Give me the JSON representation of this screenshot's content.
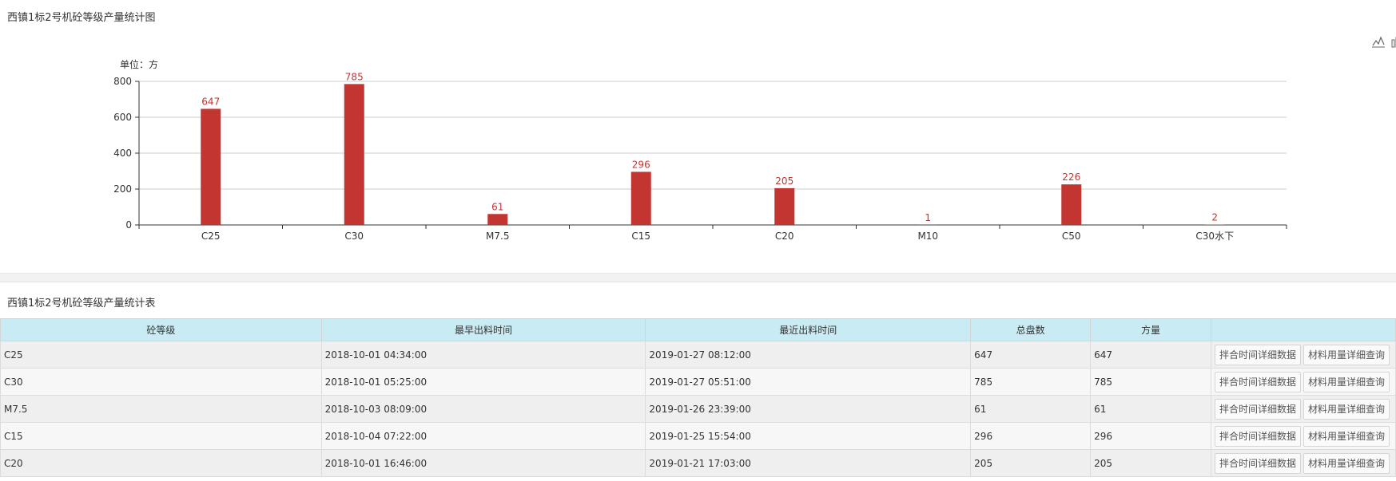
{
  "chart_panel": {
    "title": "西镇1标2号机砼等级产量统计图"
  },
  "table_panel": {
    "title": "西镇1标2号机砼等级产量统计表"
  },
  "toolbox": [
    "line-chart-icon",
    "bar-chart-icon"
  ],
  "chart_data": {
    "type": "bar",
    "title": "",
    "ylabel": "单位：方",
    "xlabel": "",
    "categories": [
      "C25",
      "C30",
      "M7.5",
      "C15",
      "C20",
      "M10",
      "C50",
      "C30水下"
    ],
    "values": [
      647,
      785,
      61,
      296,
      205,
      1,
      226,
      2
    ],
    "ylim": [
      0,
      800
    ],
    "yticks": [
      0,
      200,
      400,
      600,
      800
    ],
    "grid": true,
    "bar_color": "#c23531",
    "label_color": "#c23531"
  },
  "table": {
    "columns": [
      "砼等级",
      "最早出料时间",
      "最近出料时间",
      "总盘数",
      "方量",
      ""
    ],
    "action_labels": [
      "拌合时间详细数据",
      "材料用量详细查询"
    ],
    "rows": [
      {
        "grade": "C25",
        "first": "2018-10-01 04:34:00",
        "last": "2019-01-27 08:12:00",
        "batches": "647",
        "volume": "647"
      },
      {
        "grade": "C30",
        "first": "2018-10-01 05:25:00",
        "last": "2019-01-27 05:51:00",
        "batches": "785",
        "volume": "785"
      },
      {
        "grade": "M7.5",
        "first": "2018-10-03 08:09:00",
        "last": "2019-01-26 23:39:00",
        "batches": "61",
        "volume": "61"
      },
      {
        "grade": "C15",
        "first": "2018-10-04 07:22:00",
        "last": "2019-01-25 15:54:00",
        "batches": "296",
        "volume": "296"
      },
      {
        "grade": "C20",
        "first": "2018-10-01 16:46:00",
        "last": "2019-01-21 17:03:00",
        "batches": "205",
        "volume": "205"
      }
    ]
  }
}
